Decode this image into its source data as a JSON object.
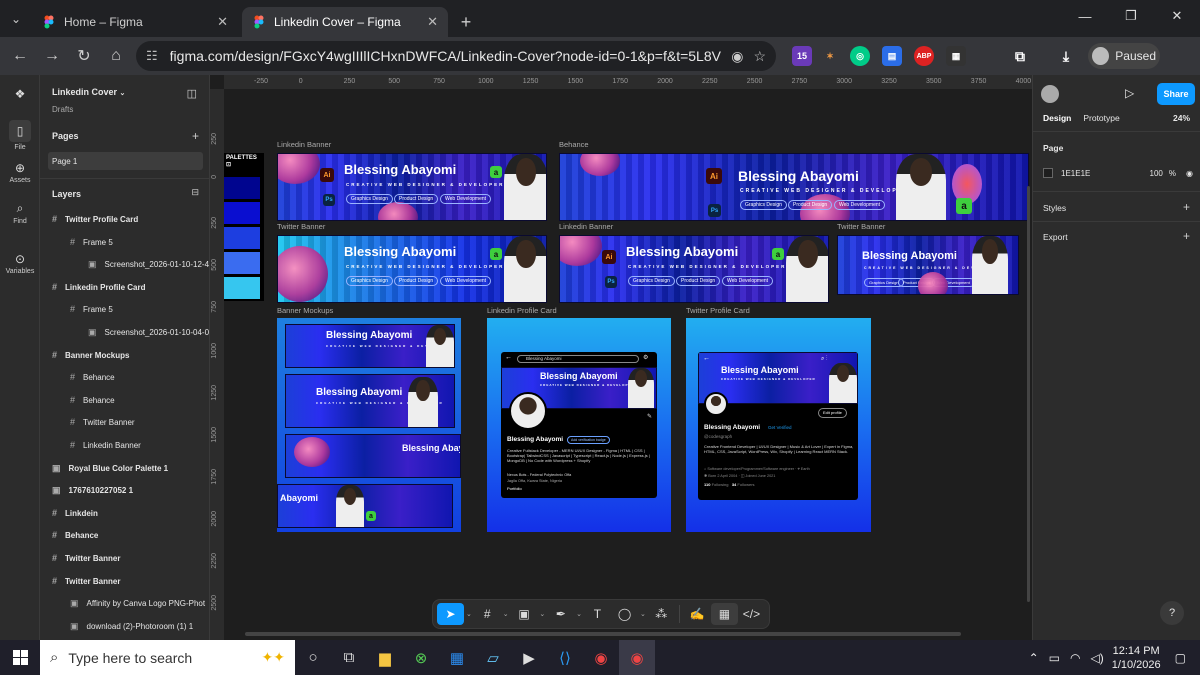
{
  "browser": {
    "tabs": [
      {
        "label": "Home – Figma",
        "active": false
      },
      {
        "label": "Linkedin Cover – Figma",
        "active": true
      }
    ],
    "url": "figma.com/design/FGxcY4wgIIIlICHxnDWFCA/Linkedin-Cover?node-id=0-1&p=f&t=5L8Vn...",
    "ext_badge": "15",
    "ext_abp": "ABP",
    "profile_status": "Paused"
  },
  "sidebar_nav": [
    {
      "label": "File",
      "icon": "file-icon"
    },
    {
      "label": "Assets",
      "icon": "assets-icon"
    },
    {
      "label": "Find",
      "icon": "find-icon"
    },
    {
      "label": "Variables",
      "icon": "variables-icon"
    }
  ],
  "file": {
    "name": "Linkedin Cover",
    "location": "Drafts"
  },
  "pages": {
    "heading": "Pages",
    "items": [
      "Page 1"
    ]
  },
  "layers": {
    "heading": "Layers",
    "items": [
      {
        "label": "Twitter Profile Card",
        "indent": 0,
        "icon": "#"
      },
      {
        "label": "Frame 5",
        "indent": 1,
        "icon": "#"
      },
      {
        "label": "Screenshot_2026-01-10-12-4",
        "indent": 2,
        "icon": "▣"
      },
      {
        "label": "Linkedin Profile Card",
        "indent": 0,
        "icon": "#"
      },
      {
        "label": "Frame 5",
        "indent": 1,
        "icon": "#"
      },
      {
        "label": "Screenshot_2026-01-10-04-0",
        "indent": 2,
        "icon": "▣"
      },
      {
        "label": "Banner Mockups",
        "indent": 0,
        "icon": "#"
      },
      {
        "label": "Behance",
        "indent": 1,
        "icon": "#"
      },
      {
        "label": "Behance",
        "indent": 1,
        "icon": "#"
      },
      {
        "label": "Twitter Banner",
        "indent": 1,
        "icon": "#"
      },
      {
        "label": "Linkedin Banner",
        "indent": 1,
        "icon": "#"
      },
      {
        "label": "Royal Blue Color Palette 1",
        "indent": 0,
        "icon": "▣"
      },
      {
        "label": "1767610227052 1",
        "indent": 0,
        "icon": "▣"
      },
      {
        "label": "Linkdein",
        "indent": 0,
        "icon": "#"
      },
      {
        "label": "Behance",
        "indent": 0,
        "icon": "#"
      },
      {
        "label": "Twitter Banner",
        "indent": 0,
        "icon": "#"
      },
      {
        "label": "Twitter Banner",
        "indent": 0,
        "icon": "#"
      },
      {
        "label": "Affinity by Canva Logo PNG-Phot",
        "indent": 1,
        "icon": "▣"
      },
      {
        "label": "download (2)-Photoroom (1) 1",
        "indent": 1,
        "icon": "▣"
      }
    ]
  },
  "ruler": {
    "top": [
      "-250",
      "0",
      "250",
      "500",
      "750",
      "1000",
      "1250",
      "1500",
      "1750",
      "2000",
      "2250",
      "2500",
      "2750",
      "3000",
      "3250",
      "3500",
      "3750",
      "4000",
      "4250"
    ],
    "left": [
      "250",
      "0",
      "250",
      "500",
      "750",
      "1000",
      "1250",
      "1500",
      "1750",
      "2000",
      "2250",
      "2500"
    ]
  },
  "frames": {
    "linkedin_banner": "Linkedin Banner",
    "behance": "Behance",
    "twitter_banner_1": "Twitter Banner",
    "linkedin_banner_2": "Linkedin Banner",
    "twitter_banner_2": "Twitter Banner",
    "banner_mockups": "Banner Mockups",
    "linkedin_profile_card": "Linkedin Profile Card",
    "twitter_profile_card": "Twitter Profile Card",
    "palette_title": "PALETTES"
  },
  "banner_content": {
    "name": "Blessing Abayomi",
    "tagline": "CREATIVE WEB DESIGNER & DEVELOPER",
    "pills": [
      "Graphics Design",
      "Product Design",
      "Web Development"
    ],
    "ai_label": "Ai",
    "ps_label": "Ps",
    "a_label": "a",
    "mock_partial_name": "Blessing Abaya",
    "mock_partial_name_2": "Abayomi"
  },
  "palette_colors": [
    "#00058f",
    "#0a0ed0",
    "#1d3ee0",
    "#3a6cf0",
    "#36c6ef"
  ],
  "linkedin_card": {
    "search": "Blessing Abayomi",
    "name": "Blessing Abayomi",
    "badge": "Add verification badge",
    "bio": "Creative Fullstack Developer - MERN UI/UX Designer - Figma | HTML | CSS | Bootstrap| TailwindCSS | Javascript | Typescript | React.js | Node.js | Express.js | MongoDB | No Code with Wordpress + Shopify",
    "edu": "Nexus Bots - Federal Polytechnic Offa",
    "loc": "Jagila Offa, Kwara State, Nigeria",
    "link": "Portfolio"
  },
  "twitter_card": {
    "name": "Blessing Abayomi",
    "verified": "Get Verified",
    "handle": "@codesgraph",
    "edit": "Edit profile",
    "bio": "Creative Frontend Developer | UI/UX Designer | Music & Art Lover | Expert in Figma, HTML, CSS, JavaScript, WordPress, Wix, Shopify | Learning React MERN Stack.",
    "meta1": "Software developer/Programmer/Software engineer",
    "meta_loc": "Earth",
    "meta2": "Born 2 April 2004",
    "joined": "Joined June 2021",
    "following_n": "110",
    "following": "Following",
    "followers_n": "34",
    "followers": "Followers"
  },
  "right_panel": {
    "share": "Share",
    "tabs": [
      "Design",
      "Prototype"
    ],
    "zoom": "24%",
    "page_heading": "Page",
    "page_color": "1E1E1E",
    "page_opacity": "100",
    "pct": "%",
    "styles": "Styles",
    "export": "Export"
  },
  "taskbar": {
    "search_placeholder": "Type here to search",
    "time": "12:14 PM",
    "date": "1/10/2026"
  }
}
